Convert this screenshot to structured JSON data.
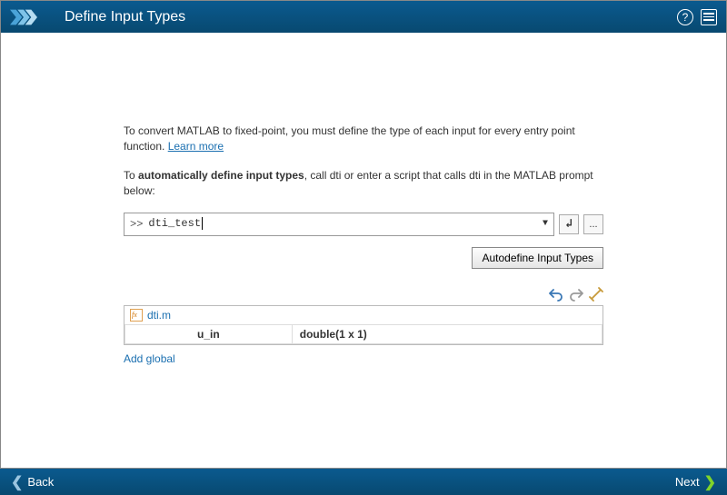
{
  "header": {
    "title": "Define Input Types"
  },
  "content": {
    "intro_pre": "To convert MATLAB to fixed-point, you must define the type of each input for every entry point function. ",
    "learn_more": "Learn more",
    "auto_pre": "To ",
    "auto_bold": "automatically define input types",
    "auto_post": ", call dti or enter a script that calls dti in the MATLAB prompt below:",
    "prompt_prefix": ">>",
    "prompt_value": " dti_test",
    "dropdown_glyph": "▼",
    "run_glyph": "↲",
    "browse_glyph": "...",
    "autodef_button": "Autodefine Input Types",
    "file_name": "dti.m",
    "var_name": "u_in",
    "var_type": "double(1 x 1)",
    "add_global": "Add global"
  },
  "footer": {
    "back": "Back",
    "next": "Next"
  }
}
